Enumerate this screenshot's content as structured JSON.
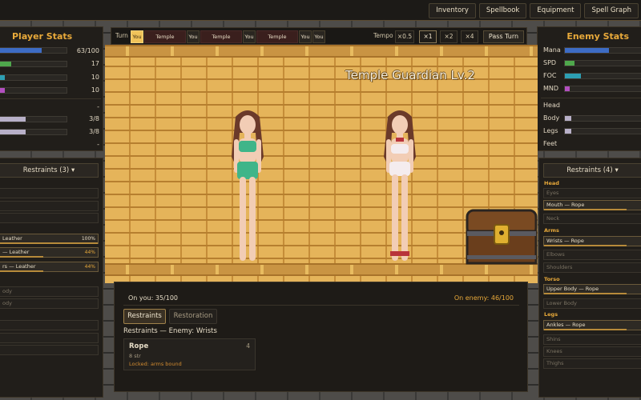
{
  "nav": {
    "inventory": "Inventory",
    "spellbook": "Spellbook",
    "equipment": "Equipment",
    "spell_graph": "Spell Graph"
  },
  "player": {
    "title": "Player Stats",
    "mana_value": "63/100",
    "mana_fraction": 0.63,
    "spd_value": "17",
    "foc_value": "10",
    "mnd_value": "10",
    "head_value": "-",
    "body_value": "3/8",
    "legs_value": "3/8",
    "feet_value": "-",
    "restraints_button": "Restraints (3) ▾",
    "slots": [
      {
        "label": "",
        "pct": ""
      },
      {
        "label": "",
        "pct": ""
      },
      {
        "label": "",
        "pct": ""
      },
      {
        "label": "Leather",
        "pct": "100%"
      },
      {
        "label": "— Leather",
        "pct": "44%"
      },
      {
        "label": "rs — Leather",
        "pct": "44%"
      },
      {
        "label": "ody",
        "pct": ""
      },
      {
        "label": "ody",
        "pct": ""
      },
      {
        "label": "",
        "pct": ""
      },
      {
        "label": "",
        "pct": ""
      },
      {
        "label": "",
        "pct": ""
      }
    ]
  },
  "enemy": {
    "title": "Enemy Stats",
    "name": "Temple Guardian Lv.2",
    "mana_label": "Mana",
    "spd_label": "SPD",
    "foc_label": "FOC",
    "mnd_label": "MND",
    "mana_fraction": 0.74,
    "head_label": "Head",
    "body_label": "Body",
    "legs_label": "Legs",
    "feet_label": "Feet",
    "restraints_button": "Restraints (4) ▾",
    "sections": {
      "head": "Head",
      "arms": "Arms",
      "torso": "Torso",
      "legs": "Legs"
    },
    "slots": {
      "eyes": "Eyes",
      "mouth": "Mouth — Rope",
      "neck": "Neck",
      "wrists": "Wrists — Rope",
      "elbows": "Elbows",
      "shoulders": "Shoulders",
      "upper_body": "Upper Body — Rope",
      "lower_body": "Lower Body",
      "ankles": "Ankles — Rope",
      "shins": "Shins",
      "knees": "Knees",
      "thighs": "Thighs"
    }
  },
  "turn": {
    "label": "Turn",
    "order": [
      "You",
      "Temple Guardian",
      "You",
      "Temple Guardian",
      "You",
      "Temple Guardian",
      "You",
      "You"
    ],
    "tempo_label": "Tempo",
    "speeds": [
      "×0.5",
      "×1",
      "×2",
      "×4"
    ],
    "active_speed": "×1",
    "pass_button": "Pass Turn"
  },
  "bottom": {
    "on_you": "On you: 35/100",
    "on_enemy": "On enemy: 46/100",
    "tabs": [
      "Restraints",
      "Restoration"
    ],
    "heading": "Restraints — Enemy: Wrists",
    "card": {
      "name": "Rope",
      "count": "4",
      "str": "8 str",
      "locked": "Locked: arms bound"
    }
  },
  "colors": {
    "accent": "#e8a93a",
    "mana": "#3d6cc4",
    "spd": "#4fa84c",
    "foc": "#2d9fb3",
    "mnd": "#b34fc0",
    "armor": "#b8b0c8"
  }
}
